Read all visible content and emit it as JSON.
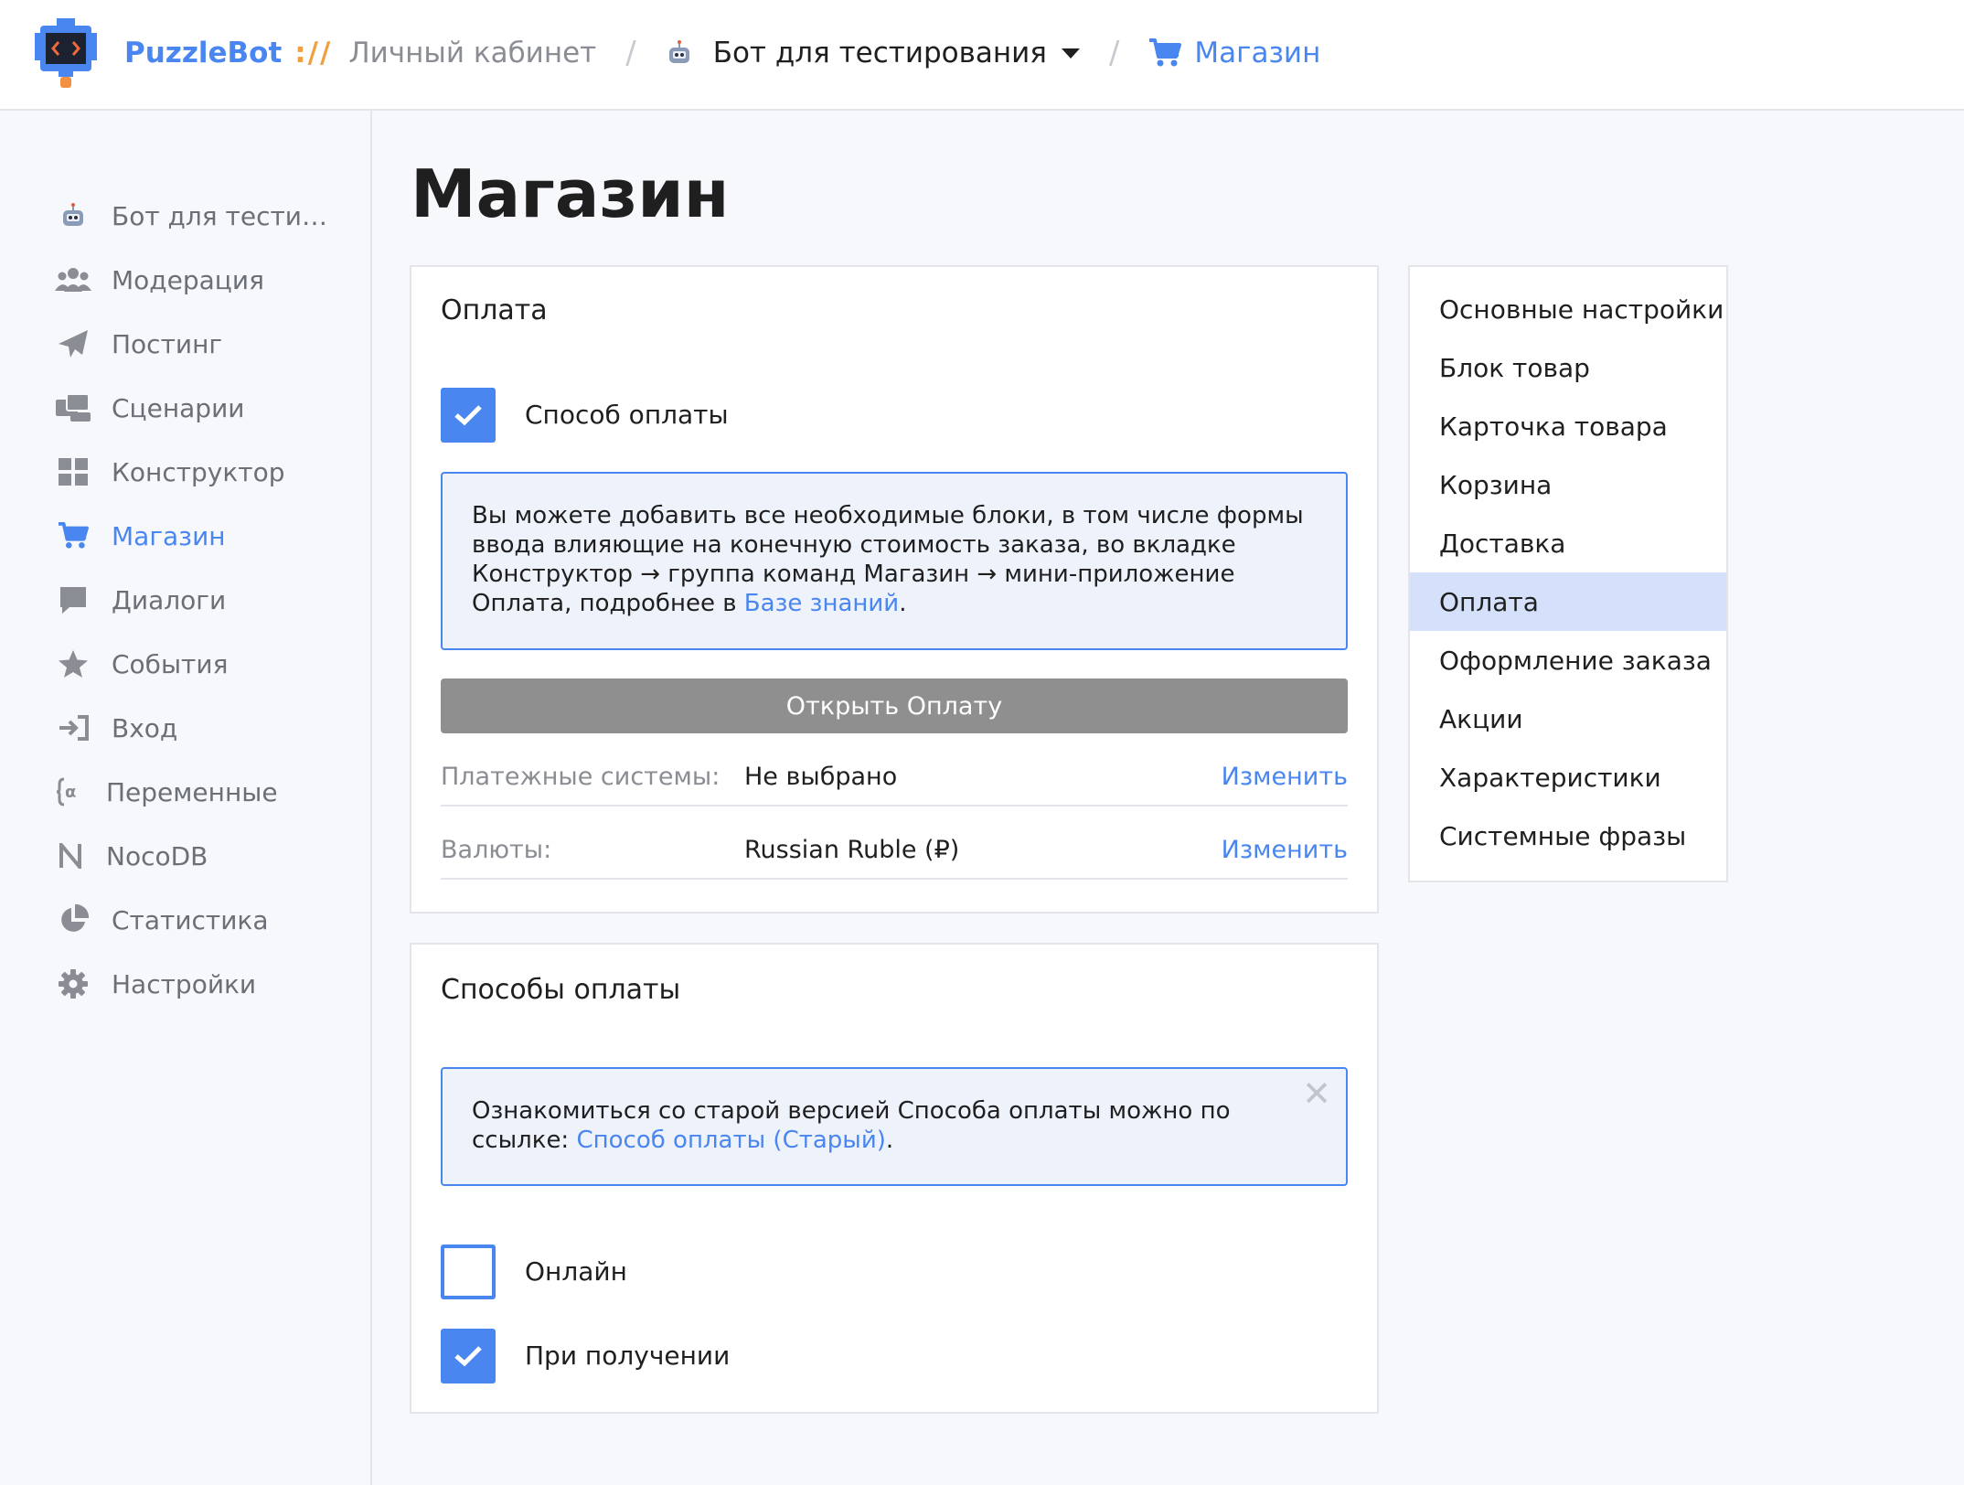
{
  "topbar": {
    "brand": "PuzzleBot",
    "brand_sep": "://",
    "cabinet": "Личный кабинет",
    "bot_name": "Бот для тестирования",
    "section": "Магазин"
  },
  "sidebar": {
    "items": [
      {
        "label": "Бот для тести…",
        "icon": "bot-icon"
      },
      {
        "label": "Модерация",
        "icon": "users-icon"
      },
      {
        "label": "Постинг",
        "icon": "paper-plane-icon"
      },
      {
        "label": "Сценарии",
        "icon": "scenarios-icon"
      },
      {
        "label": "Конструктор",
        "icon": "grid-icon"
      },
      {
        "label": "Магазин",
        "icon": "cart-icon",
        "active": true
      },
      {
        "label": "Диалоги",
        "icon": "chat-icon"
      },
      {
        "label": "События",
        "icon": "star-icon"
      },
      {
        "label": "Вход",
        "icon": "sign-in-icon"
      },
      {
        "label": "Переменные",
        "icon": "variable-icon"
      },
      {
        "label": "NocoDB",
        "icon": "nocodb-icon"
      },
      {
        "label": "Статистика",
        "icon": "pie-chart-icon"
      },
      {
        "label": "Настройки",
        "icon": "gear-icon"
      }
    ]
  },
  "main": {
    "title": "Магазин",
    "payment": {
      "title": "Оплата",
      "checkbox_label": "Способ оплаты",
      "checkbox_checked": true,
      "info_text": "Вы можете добавить все необходимые блоки, в том числе формы ввода влияющие на конечную стоимость заказа, во вкладке Конструктор → группа команд Магазин → мини-приложение Оплата, подробнее в ",
      "info_link": "Базе знаний",
      "info_end": ".",
      "open_button": "Открыть Оплату",
      "rows": [
        {
          "key": "Платежные системы:",
          "value": "Не выбрано",
          "action": "Изменить"
        },
        {
          "key": "Валюты:",
          "value": "Russian Ruble (₽)",
          "action": "Изменить"
        }
      ]
    },
    "methods": {
      "title": "Способы оплаты",
      "notice_text": "Ознакомиться со старой версией Способа оплаты можно по ссылке: ",
      "notice_link": "Способ оплаты (Старый)",
      "notice_end": ".",
      "close": "✕",
      "options": [
        {
          "label": "Онлайн",
          "checked": false
        },
        {
          "label": "При получении",
          "checked": true
        }
      ]
    }
  },
  "right_nav": {
    "items": [
      {
        "label": "Основные настройки"
      },
      {
        "label": "Блок товар"
      },
      {
        "label": "Карточка товара"
      },
      {
        "label": "Корзина"
      },
      {
        "label": "Доставка"
      },
      {
        "label": "Оплата",
        "active": true
      },
      {
        "label": "Оформление заказа"
      },
      {
        "label": "Акции"
      },
      {
        "label": "Характеристики"
      },
      {
        "label": "Системные фразы"
      }
    ]
  },
  "colors": {
    "accent": "#4a86f0",
    "brand_sep": "#f0a040",
    "active_nav_bg": "#d5e1fa",
    "button_grey": "#8f8f8f",
    "info_bg": "#eef2fb"
  }
}
